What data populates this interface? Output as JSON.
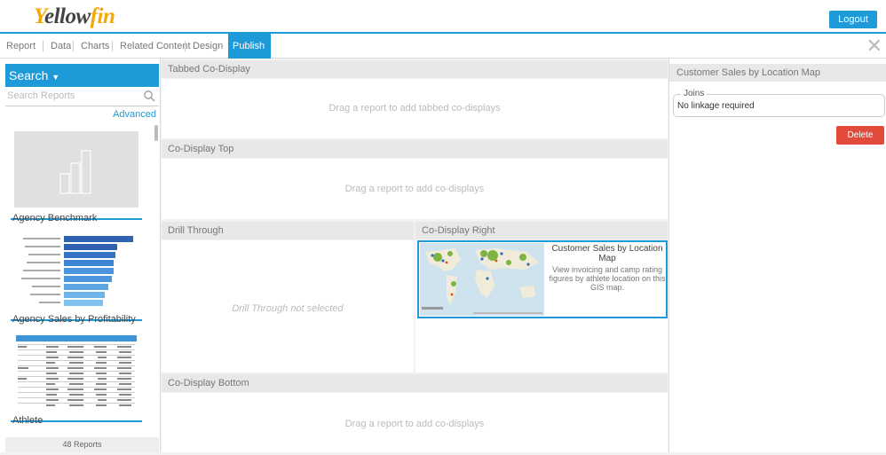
{
  "logo": {
    "y": "Y",
    "rest": "ellow",
    "fin": "fin"
  },
  "header": {
    "logout_label": "Logout"
  },
  "tabs": [
    {
      "label": "Report"
    },
    {
      "label": "Data"
    },
    {
      "label": "Charts"
    },
    {
      "label": "Related Content"
    },
    {
      "label": "Design"
    },
    {
      "label": "Publish"
    }
  ],
  "sidebar": {
    "title": "Search",
    "search_placeholder": "Search Reports",
    "advanced_label": "Advanced",
    "reports": [
      {
        "label": "Agency Benchmark"
      },
      {
        "label": "Agency Sales by Profitability"
      },
      {
        "label": "Athlete"
      }
    ],
    "footer": "48 Reports"
  },
  "main": {
    "tabbed": {
      "title": "Tabbed Co-Display",
      "hint": "Drag a report to add tabbed co-displays"
    },
    "top": {
      "title": "Co-Display Top",
      "hint": "Drag a report to add co-displays"
    },
    "drill": {
      "title": "Drill Through",
      "hint": "Drill Through not selected"
    },
    "right": {
      "title": "Co-Display Right",
      "card_title": "Customer Sales by Location Map",
      "card_desc": "View invoicing and camp rating figures by athlete location on this GIS map."
    },
    "bottom": {
      "title": "Co-Display Bottom",
      "hint": "Drag a report to add co-displays"
    }
  },
  "panel": {
    "title": "Customer Sales by Location Map",
    "joins_label": "Joins",
    "joins_value": "No linkage required",
    "delete_label": "Delete"
  },
  "colors": {
    "accent": "#1e9ad9",
    "delete": "#e24b3b",
    "brand": "#f5a800"
  }
}
